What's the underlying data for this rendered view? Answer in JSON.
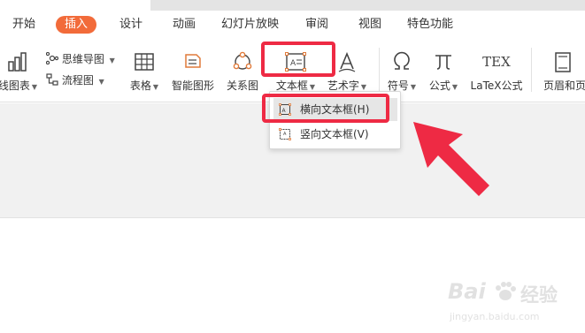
{
  "tabs": [
    {
      "label": "开始"
    },
    {
      "label": "插入",
      "active": true
    },
    {
      "label": "设计"
    },
    {
      "label": "动画"
    },
    {
      "label": "幻灯片放映"
    },
    {
      "label": "审阅"
    },
    {
      "label": "视图"
    },
    {
      "label": "特色功能"
    }
  ],
  "ribbon": {
    "chart_label": "线图表",
    "mindmap_label": "思维导图",
    "flowchart_label": "流程图",
    "table_label": "表格",
    "smartart_label": "智能图形",
    "relation_label": "关系图",
    "textbox_label": "文本框",
    "wordart_label": "艺术字",
    "symbol_label": "符号",
    "formula_label": "公式",
    "latex_label": "LaTeX公式",
    "header_label": "页眉和页",
    "latex_icon_text": "TEX"
  },
  "textbox_menu": {
    "items": [
      {
        "label": "横向文本框(H)",
        "highlighted": true
      },
      {
        "label": "竖向文本框(V)",
        "highlighted": false
      }
    ]
  },
  "colors": {
    "accent": "#f26b3a",
    "highlight_red": "#ee2a44",
    "arrow_red": "#ee2a44"
  },
  "watermark": {
    "brand": "Bai",
    "brand_cn": "经验",
    "url": "jingyan.baidu.com"
  }
}
